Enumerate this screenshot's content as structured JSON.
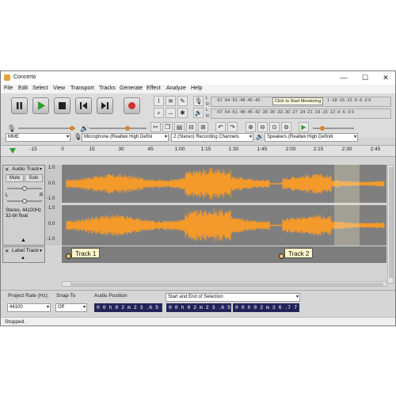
{
  "app": {
    "title": "Concerto"
  },
  "window_controls": {
    "minimize": "—",
    "maximize": "☐",
    "close": "✕"
  },
  "menu": [
    "File",
    "Edit",
    "Select",
    "View",
    "Transport",
    "Tracks",
    "Generate",
    "Effect",
    "Analyze",
    "Help"
  ],
  "transport": {
    "buttons": [
      "pause",
      "play",
      "stop",
      "skip-to-start",
      "skip-to-end",
      "record"
    ]
  },
  "meters": {
    "record_scale": "-57 -54 -51 -48 -45 -42 -",
    "record_tip": "Click to Start Monitoring",
    "record_scale_right": "1 -18 -15 -12 -9 -6 -3 0",
    "playback_scale": "-57 -54 -51 -48 -45 -42 -39 -36 -33 -30 -27 -24 -21 -18 -15 -12 -9 -6 -3 0",
    "record_channel_l": "L",
    "record_channel_r": "R",
    "playback_channel_l": "L",
    "playback_channel_r": "R"
  },
  "devices": {
    "host": "MME",
    "recording_device": "Microphone (Realtek High Defini",
    "channels": "2 (Stereo) Recording Channels",
    "playback_device": "Speakers (Realtek High Definiti"
  },
  "timeline": {
    "ticks": [
      "-15",
      "0",
      "15",
      "30",
      "45",
      "1:00",
      "1:15",
      "1:30",
      "1:45",
      "2:00",
      "2:15",
      "2:30",
      "2:45"
    ]
  },
  "audio_track": {
    "name": "Audio Track",
    "mute": "Mute",
    "solo": "Solo",
    "pan_l": "L",
    "pan_r": "R",
    "info": "Stereo, 44100Hz\n32-bit float",
    "scale": [
      "1.0",
      "0.0",
      "-1.0",
      "1.0",
      "0.0",
      "-1.0"
    ],
    "wave_color": "#f39a2b"
  },
  "label_track": {
    "name": "Label Track",
    "labels": [
      "Track 1",
      "Track 2"
    ]
  },
  "selection_toolbar": {
    "project_rate_label": "Project Rate (Hz):",
    "project_rate": "44100",
    "snap_to_label": "Snap-To",
    "snap_to": "Off",
    "audio_position_label": "Audio Position",
    "audio_position": "0 0 h 0 2 m 2 3 .6 5 3 s",
    "selection_mode": "Start and End of Selection",
    "selection_start": "0 0 h 0 2 m 2 3 .6 5 3 s",
    "selection_end": "0 0 h 0 2 m 3 6 .7 7 6 s"
  },
  "status": {
    "text": "Stopped."
  },
  "colors": {
    "accent": "#3a8fd8",
    "record": "#d32f2f",
    "play": "#2e9e2e",
    "timecode_bg": "#23235a"
  }
}
